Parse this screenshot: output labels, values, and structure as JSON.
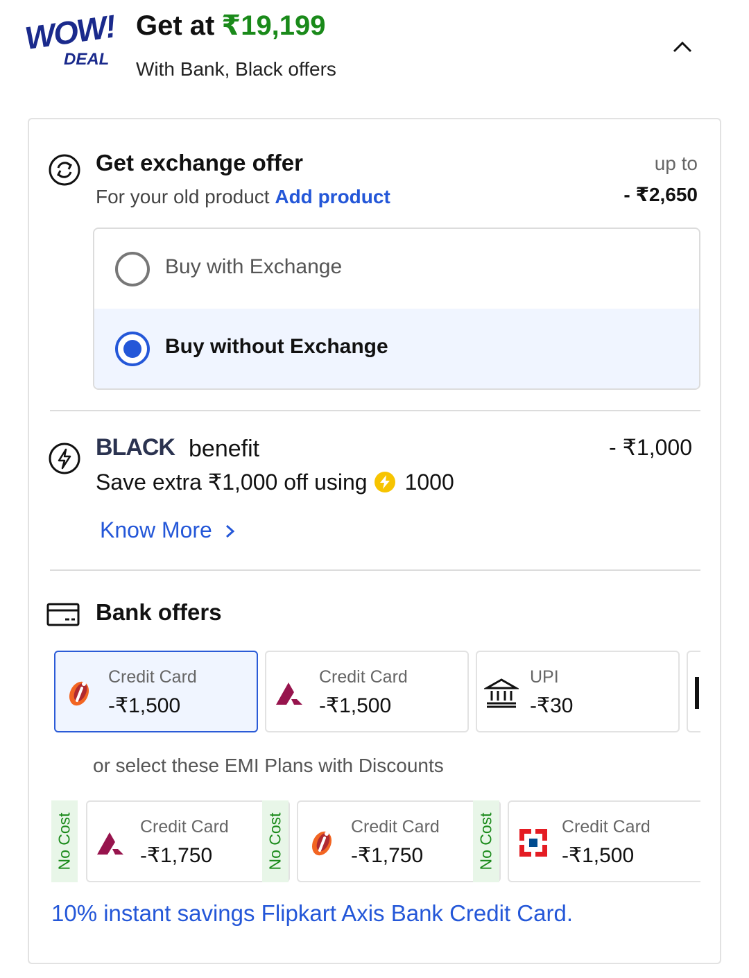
{
  "header": {
    "badge_top": "WOW!",
    "badge_bottom": "DEAL",
    "get_label": "Get at",
    "get_price": "₹19,199",
    "subtitle": "With Bank, Black offers"
  },
  "exchange": {
    "title": "Get exchange offer",
    "subtitle_prefix": "For your old product",
    "add_product": "Add product",
    "upto_label": "up to",
    "upto_value": "- ₹2,650",
    "options": [
      {
        "label": "Buy with Exchange",
        "selected": false
      },
      {
        "label": "Buy without Exchange",
        "selected": true
      }
    ]
  },
  "black": {
    "brand": "BLACK",
    "title": "benefit",
    "value": "- ₹1,000",
    "save_text": "Save extra ₹1,000 off using",
    "coins": "1000",
    "know_more": "Know More"
  },
  "bank": {
    "title": "Bank offers",
    "offers": [
      {
        "label": "Credit Card",
        "value": "-₹1,500",
        "logo": "icici-logo-icon",
        "selected": true
      },
      {
        "label": "Credit Card",
        "value": "-₹1,500",
        "logo": "axis-logo-icon",
        "selected": false
      },
      {
        "label": "UPI",
        "value": "-₹30",
        "logo": "bank-building-icon",
        "selected": false
      }
    ],
    "emi_title": "or select these EMI Plans with Discounts",
    "emi_badge": "No Cost",
    "emi": [
      {
        "label": "Credit Card",
        "value": "-₹1,750",
        "logo": "axis-logo-icon"
      },
      {
        "label": "Credit Card",
        "value": "-₹1,750",
        "logo": "icici-logo-icon"
      },
      {
        "label": "Credit Card",
        "value": "-₹1,500",
        "logo": "hdfc-logo-icon"
      }
    ],
    "footer": "10% instant savings Flipkart Axis Bank Credit Card."
  },
  "colors": {
    "price_green": "#1a8a1a",
    "link_blue": "#2457d8",
    "selected_bg": "#f0f5ff",
    "nocost_bg": "#e8f6e8"
  }
}
